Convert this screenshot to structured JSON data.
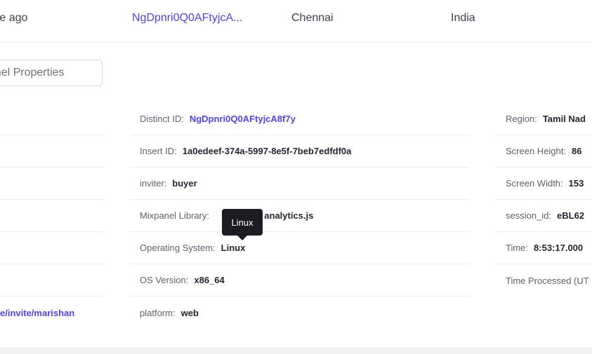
{
  "top_row": {
    "time": "ute ago",
    "distinct_id": "NgDpnri0Q0AFtyjcA...",
    "city": "Chennai",
    "country": "India"
  },
  "tab": {
    "label": "panel Properties"
  },
  "left_column": {
    "link_value": "e/invite/marishan"
  },
  "properties": [
    {
      "label": "Distinct ID:",
      "value": "NgDpnri0Q0AFtyjcA8f7y"
    },
    {
      "label": "Insert ID:",
      "value": "1a0edeef-374a-5997-8e5f-7beb7edfdf0a"
    },
    {
      "label": "inviter:",
      "value": "buyer"
    },
    {
      "label": "Mixpanel Library:",
      "value": "t: analytics.js"
    },
    {
      "label": "Operating System:",
      "value": "Linux"
    },
    {
      "label": "OS Version:",
      "value": "x86_64"
    },
    {
      "label": "platform:",
      "value": "web"
    }
  ],
  "right_properties": [
    {
      "label": "Region:",
      "value": "Tamil Nad"
    },
    {
      "label": "Screen Height:",
      "value": "86"
    },
    {
      "label": "Screen Width:",
      "value": "153"
    },
    {
      "label": "session_id:",
      "value": "eBL62"
    },
    {
      "label": "Time:",
      "value": "8:53:17.000"
    },
    {
      "label": "Time Processed (UT",
      "value": ""
    }
  ],
  "tooltip": {
    "text": "Linux"
  },
  "colors": {
    "accent": "#4f44e0",
    "tooltip_bg": "#1b1d22"
  }
}
